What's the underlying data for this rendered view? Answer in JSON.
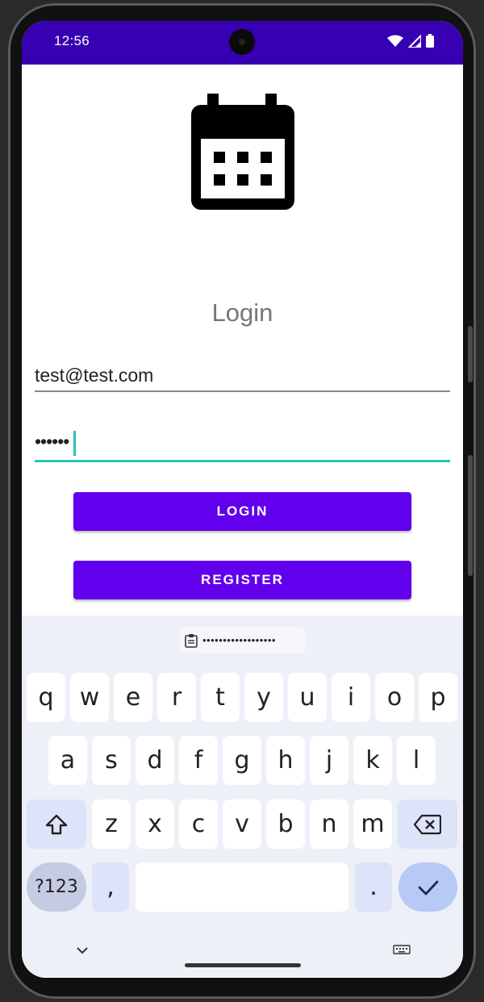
{
  "status_bar": {
    "time": "12:56",
    "icons": [
      "wifi-icon",
      "signal-icon",
      "battery-icon"
    ],
    "background": "#3700b3"
  },
  "app": {
    "logo_icon": "calendar-icon",
    "title": "Login",
    "email_value": "test@test.com",
    "password_value": "••••••",
    "login_label": "LOGIN",
    "register_label": "REGISTER",
    "accent_color": "#6200ee",
    "focus_color": "#26c6b4"
  },
  "keyboard": {
    "clipboard_icon": "clipboard-icon",
    "clipboard_text": "••••••••••••••••••",
    "row1": [
      "q",
      "w",
      "e",
      "r",
      "t",
      "y",
      "u",
      "i",
      "o",
      "p"
    ],
    "row2": [
      "a",
      "s",
      "d",
      "f",
      "g",
      "h",
      "j",
      "k",
      "l"
    ],
    "row3": [
      "z",
      "x",
      "c",
      "v",
      "b",
      "n",
      "m"
    ],
    "symbols_label": "?123",
    "comma_label": ",",
    "period_label": ".",
    "shift_icon": "shift-icon",
    "backspace_icon": "backspace-icon",
    "enter_icon": "check-icon",
    "collapse_icon": "chevron-down-icon",
    "switch_keyboard_icon": "keyboard-icon"
  }
}
